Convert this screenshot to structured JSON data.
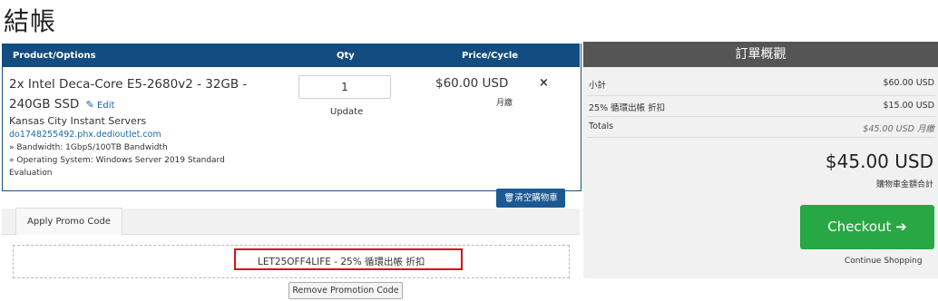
{
  "page": {
    "title": "結帳"
  },
  "cart": {
    "headers": {
      "product": "Product/Options",
      "qty": "Qty",
      "price": "Price/Cycle"
    },
    "item": {
      "name": "2x Intel Deca-Core E5-2680v2 - 32GB - 240GB SSD",
      "edit_label": "Edit",
      "group": "Kansas City Instant Servers",
      "domain": "do1748255492.phx.dedioutlet.com",
      "config": [
        "» Bandwidth: 1GbpS/100TB Bandwidth",
        "» Operating System: Windows Server 2019 Standard Evaluation"
      ],
      "qty": "1",
      "update_label": "Update",
      "price": "$60.00 USD",
      "cycle": "月繳",
      "remove_icon": "×"
    },
    "empty_cart_label": "清空購物車"
  },
  "promo": {
    "tab_label": "Apply Promo Code",
    "applied_text": "LET25OFF4LIFE - 25% 循環出帳 折扣",
    "remove_label": "Remove Promotion Code",
    "highlight_color": "#d1141b"
  },
  "summary": {
    "title": "訂單概觀",
    "subtotal_label": "小計",
    "subtotal_value": "$60.00 USD",
    "discount_label": "25% 循環出帳 折扣",
    "discount_value": "$15.00 USD",
    "totals_label": "Totals",
    "totals_value": "$45.00 USD 月繳",
    "total_due": "$45.00 USD",
    "total_caption": "購物車金額合計",
    "checkout_label": "Checkout",
    "checkout_arrow": "➔",
    "continue_label": "Continue Shopping"
  },
  "colors": {
    "header_blue": "#124c80",
    "summary_header": "#555555",
    "checkout_green": "#28a745"
  }
}
